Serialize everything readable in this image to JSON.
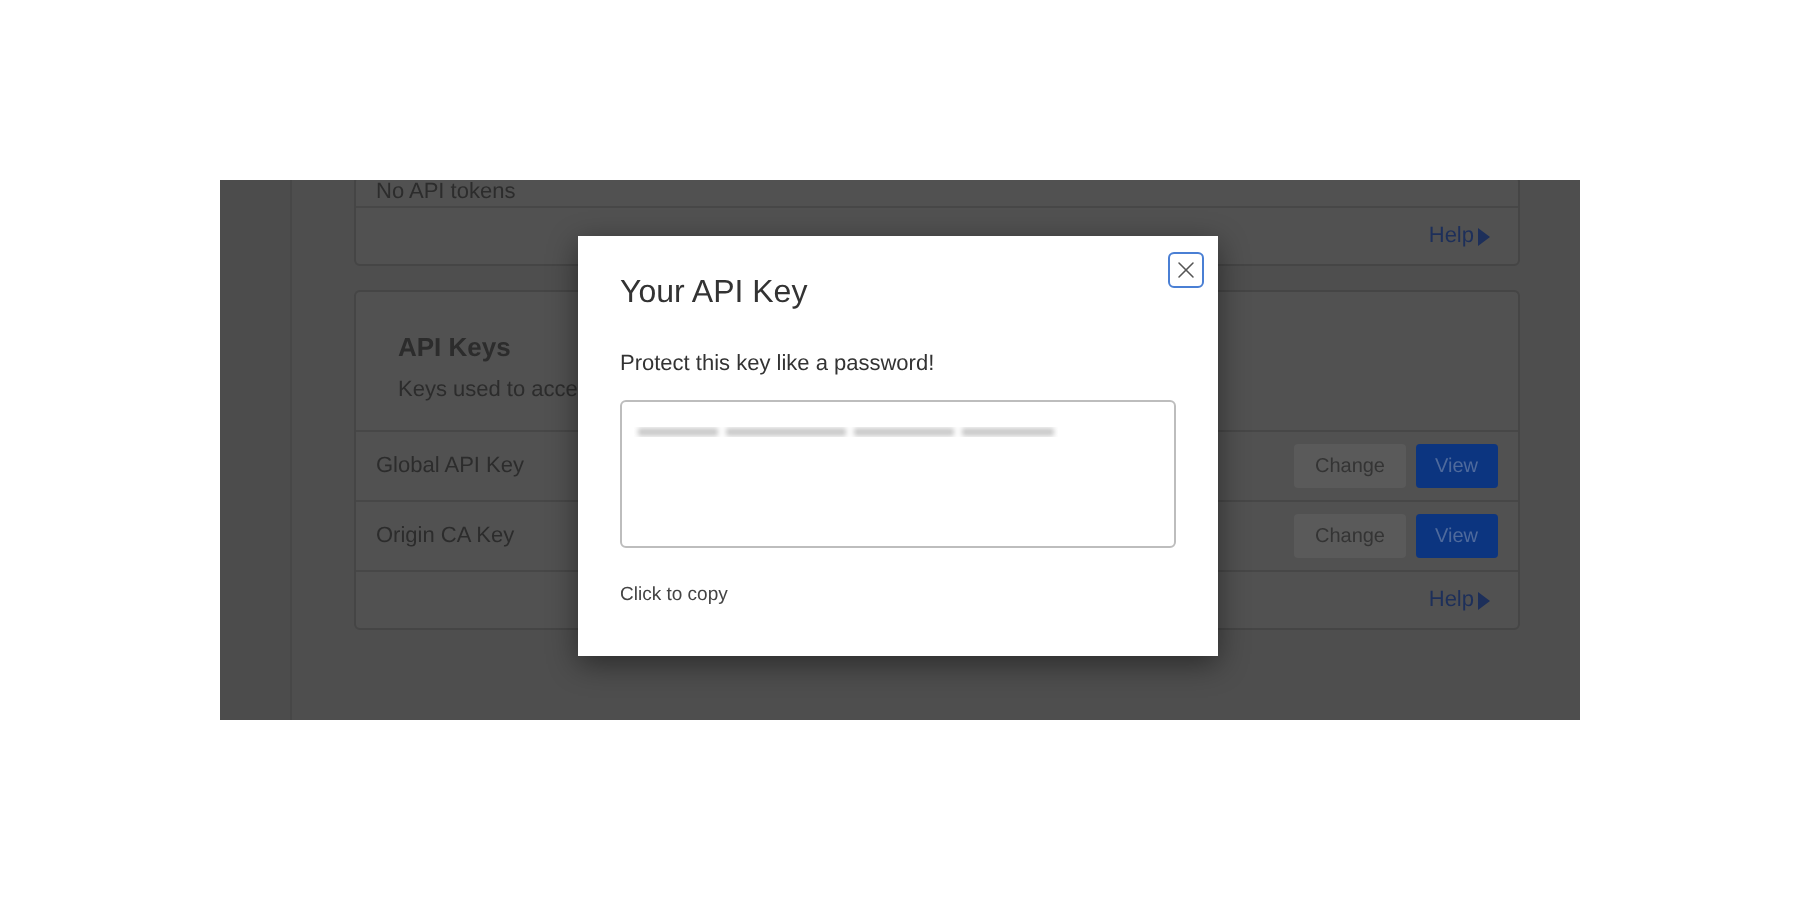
{
  "background": {
    "tokens_card": {
      "empty_text": "No API tokens",
      "help_link": "Help"
    },
    "api_keys_card": {
      "title": "API Keys",
      "description": "Keys used to acce",
      "keys": [
        {
          "name": "Global API Key",
          "change_button": "Change",
          "view_button": "View"
        },
        {
          "name": "Origin CA Key",
          "change_button": "Change",
          "view_button": "View"
        }
      ],
      "help_link": "Help"
    }
  },
  "dialog": {
    "title": "Your API Key",
    "warning": "Protect this key like a password!",
    "hint": "Click to copy"
  }
}
